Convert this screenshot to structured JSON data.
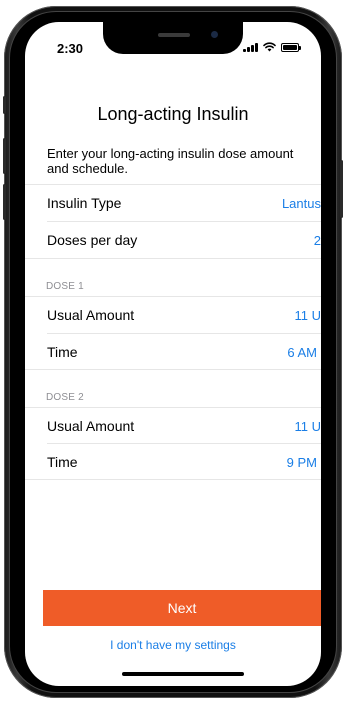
{
  "status_bar": {
    "time": "2:30"
  },
  "page": {
    "title": "Long-acting Insulin",
    "subtitle": "Enter your long-acting insulin dose amount and schedule."
  },
  "settings": {
    "insulin_type": {
      "label": "Insulin Type",
      "value": "Lantus"
    },
    "doses_per_day": {
      "label": "Doses per day",
      "value": "2"
    }
  },
  "doses": [
    {
      "header": "DOSE 1",
      "amount": {
        "label": "Usual Amount",
        "value": "11 U"
      },
      "time": {
        "label": "Time",
        "value": "6 AM"
      }
    },
    {
      "header": "DOSE 2",
      "amount": {
        "label": "Usual Amount",
        "value": "11 U"
      },
      "time": {
        "label": "Time",
        "value": "9 PM"
      }
    }
  ],
  "actions": {
    "next_label": "Next",
    "no_settings_label": "I don't have my settings"
  },
  "colors": {
    "accent": "#1a7ee6",
    "primary_button": "#ef5c28",
    "section_header": "#8e8e93"
  },
  "icons": [
    "signal-icon",
    "wifi-icon",
    "battery-icon"
  ]
}
